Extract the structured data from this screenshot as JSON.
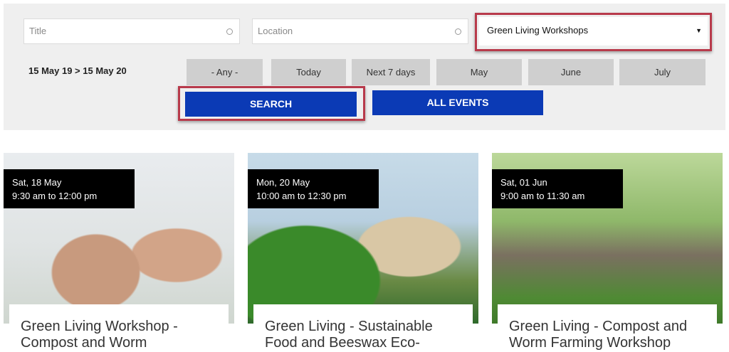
{
  "filters": {
    "title_placeholder": "Title",
    "location_placeholder": "Location",
    "category_selected": "Green Living Workshops",
    "date_range": "15 May 19 > 15 May 20",
    "periods": [
      "- Any -",
      "Today",
      "Next 7 days",
      "May",
      "June",
      "July"
    ],
    "search_label": "SEARCH",
    "all_events_label": "ALL EVENTS"
  },
  "events": [
    {
      "date": "Sat, 18 May",
      "time": "9:30 am to 12:00 pm",
      "title_line1": "Green Living Workshop -",
      "title_line2": "Compost and Worm"
    },
    {
      "date": "Mon, 20 May",
      "time": "10:00 am to 12:30 pm",
      "title_line1": "Green Living - Sustainable",
      "title_line2": "Food and Beeswax Eco-"
    },
    {
      "date": "Sat, 01 Jun",
      "time": "9:00 am to 11:30 am",
      "title_line1": "Green Living - Compost and",
      "title_line2": "Worm Farming Workshop"
    }
  ],
  "colors": {
    "button": "#0b3ab5",
    "highlight": "#b83a4b",
    "panel": "#efefef"
  }
}
